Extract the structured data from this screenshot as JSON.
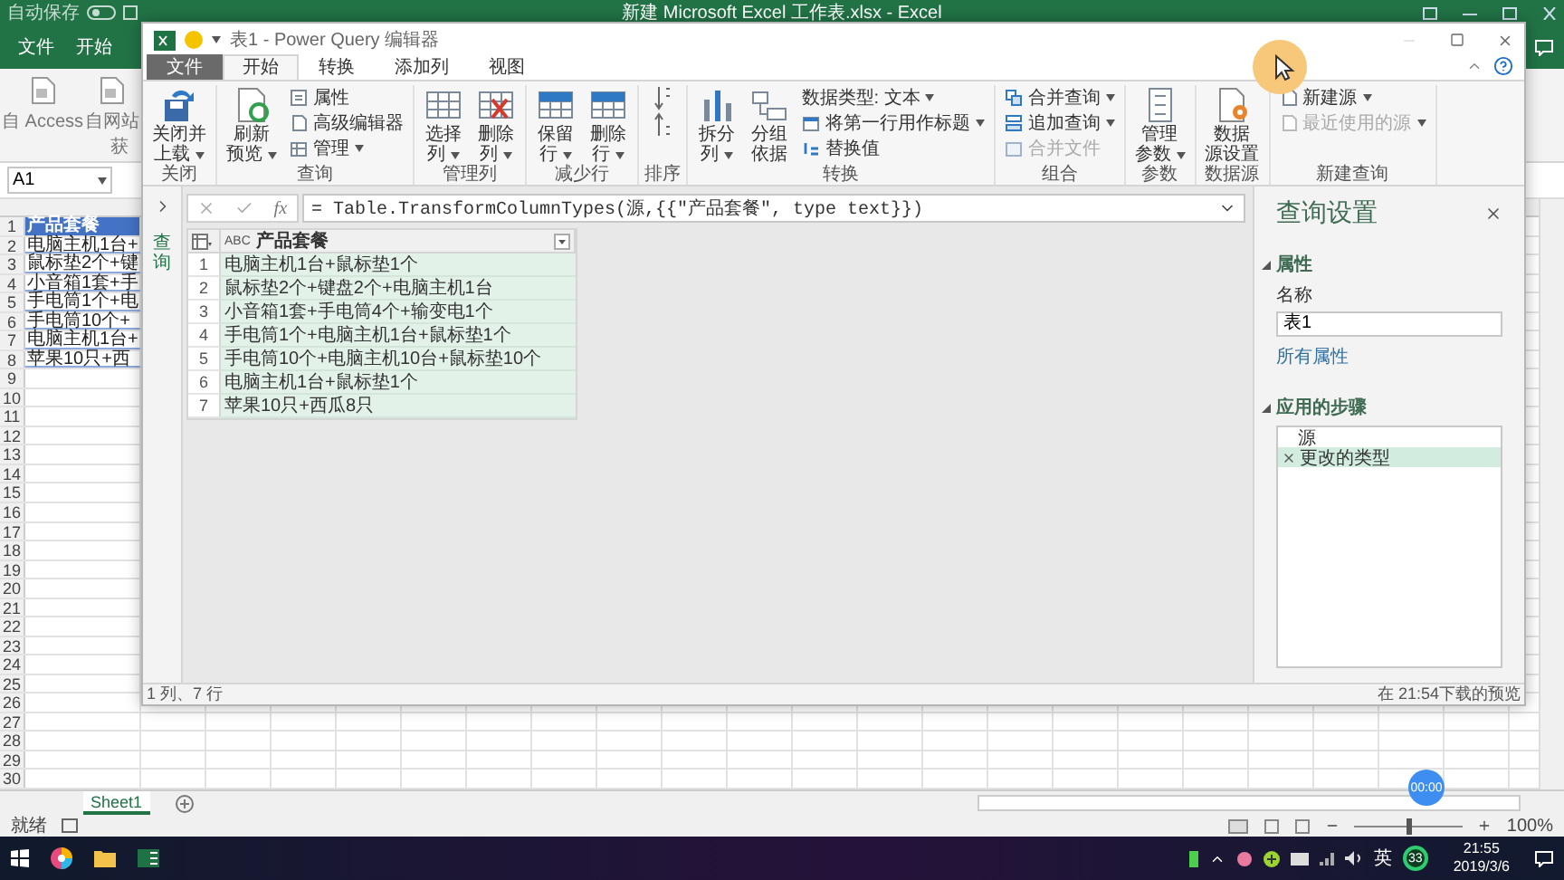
{
  "excel": {
    "autosave": "自动保存",
    "title": "新建 Microsoft Excel 工作表.xlsx - Excel",
    "tabs": [
      "文件",
      "开始"
    ],
    "ribbon_buttons": [
      "自 Access",
      "自网站"
    ],
    "group_label": "获",
    "name_box": "A1",
    "row_numbers": [
      "1",
      "2",
      "3",
      "4",
      "5",
      "6",
      "7",
      "8",
      "9",
      "10",
      "11",
      "12",
      "13",
      "14",
      "15",
      "16",
      "17",
      "18",
      "19",
      "20",
      "21",
      "22",
      "23",
      "24",
      "25",
      "26",
      "27",
      "28",
      "29",
      "30"
    ],
    "column_a": [
      {
        "kind": "header",
        "text": "产品套餐"
      },
      {
        "kind": "cell",
        "text": "电脑主机1台+"
      },
      {
        "kind": "cell",
        "text": "鼠标垫2个+键"
      },
      {
        "kind": "cell",
        "text": "小音箱1套+手"
      },
      {
        "kind": "cell",
        "text": "手电筒1个+电"
      },
      {
        "kind": "cell",
        "text": "手电筒10个+"
      },
      {
        "kind": "cell",
        "text": "电脑主机1台+"
      },
      {
        "kind": "cell",
        "text": "苹果10只+西"
      }
    ],
    "sheet_tabs": [
      {
        "label": "Sheet1",
        "selected": true
      }
    ],
    "status": "就绪",
    "zoom": {
      "level": 0.5,
      "reading": "100%"
    }
  },
  "editor": {
    "title": "表1 - Power Query 编辑器",
    "tabs": [
      {
        "kind": "file",
        "label": "文件",
        "selected": false
      },
      {
        "kind": "tab",
        "label": "开始",
        "selected": true
      },
      {
        "kind": "tab",
        "label": "转换",
        "selected": false
      },
      {
        "kind": "tab",
        "label": "添加列",
        "selected": false
      },
      {
        "kind": "tab",
        "label": "视图",
        "selected": false
      }
    ],
    "ribbon": [
      {
        "label": "关闭",
        "buttons": [
          {
            "kind": "large",
            "lines": [
              "关闭并",
              "上载"
            ],
            "dropdown": true,
            "disabled": false
          }
        ]
      },
      {
        "label": "查询",
        "buttons": [
          {
            "kind": "large",
            "lines": [
              "刷新",
              "预览"
            ],
            "dropdown": true,
            "disabled": false
          },
          {
            "kind": "small",
            "text": "属性",
            "dropdown": false,
            "disabled": false
          },
          {
            "kind": "small",
            "text": "高级编辑器",
            "dropdown": false,
            "disabled": false
          },
          {
            "kind": "small",
            "text": "管理",
            "dropdown": true,
            "disabled": false
          }
        ]
      },
      {
        "label": "管理列",
        "buttons": [
          {
            "kind": "large",
            "lines": [
              "选择",
              "列"
            ],
            "dropdown": true,
            "disabled": false
          },
          {
            "kind": "large",
            "lines": [
              "删除",
              "列"
            ],
            "dropdown": true,
            "disabled": false
          }
        ]
      },
      {
        "label": "减少行",
        "buttons": [
          {
            "kind": "large",
            "lines": [
              "保留",
              "行"
            ],
            "dropdown": true,
            "disabled": false
          },
          {
            "kind": "large",
            "lines": [
              "删除",
              "行"
            ],
            "dropdown": true,
            "disabled": false
          }
        ]
      },
      {
        "label": "排序",
        "buttons": [
          {
            "kind": "sort"
          }
        ]
      },
      {
        "label": "转换",
        "buttons": [
          {
            "kind": "large",
            "lines": [
              "拆分",
              "列"
            ],
            "dropdown": true,
            "disabled": false
          },
          {
            "kind": "large",
            "lines": [
              "分组",
              "依据"
            ],
            "dropdown": false,
            "disabled": false
          },
          {
            "kind": "small",
            "text": "数据类型: 文本",
            "dropdown": true,
            "disabled": false
          },
          {
            "kind": "small",
            "text": "将第一行用作标题",
            "dropdown": true,
            "disabled": false
          },
          {
            "kind": "small",
            "text": "替换值",
            "dropdown": false,
            "disabled": false
          }
        ]
      },
      {
        "label": "组合",
        "buttons": [
          {
            "kind": "small",
            "text": "合并查询",
            "dropdown": true,
            "disabled": false
          },
          {
            "kind": "small",
            "text": "追加查询",
            "dropdown": true,
            "disabled": false
          },
          {
            "kind": "small",
            "text": "合并文件",
            "dropdown": false,
            "disabled": true
          }
        ]
      },
      {
        "label": "参数",
        "buttons": [
          {
            "kind": "large",
            "lines": [
              "管理",
              "参数"
            ],
            "dropdown": true,
            "disabled": false
          }
        ]
      },
      {
        "label": "数据源",
        "buttons": [
          {
            "kind": "large",
            "lines": [
              "数据",
              "源设置"
            ],
            "dropdown": false,
            "disabled": false
          }
        ]
      },
      {
        "label": "新建查询",
        "buttons": [
          {
            "kind": "small",
            "text": "新建源",
            "dropdown": true,
            "disabled": false
          },
          {
            "kind": "small",
            "text": "最近使用的源",
            "dropdown": true,
            "disabled": true
          }
        ]
      }
    ],
    "queries_label": "查询",
    "formula_label": "fx",
    "formula": "= Table.TransformColumnTypes(源,{{\"产品套餐\", type text}})",
    "table": {
      "column_type": "ABC",
      "column": "产品套餐",
      "rows": [
        {
          "n": "1",
          "text": "电脑主机1台+鼠标垫1个"
        },
        {
          "n": "2",
          "text": "鼠标垫2个+键盘2个+电脑主机1台"
        },
        {
          "n": "3",
          "text": "小音箱1套+手电筒4个+输变电1个"
        },
        {
          "n": "4",
          "text": "手电筒1个+电脑主机1台+鼠标垫1个"
        },
        {
          "n": "5",
          "text": "手电筒10个+电脑主机10台+鼠标垫10个"
        },
        {
          "n": "6",
          "text": "电脑主机1台+鼠标垫1个"
        },
        {
          "n": "7",
          "text": "苹果10只+西瓜8只"
        }
      ]
    },
    "settings": {
      "title": "查询设置",
      "properties": {
        "heading": "属性",
        "expanded": true,
        "name_label": "名称",
        "name_value": "表1",
        "link": "所有属性"
      },
      "steps": {
        "heading": "应用的步骤",
        "expanded": true,
        "items": [
          {
            "label": "源",
            "selected": false
          },
          {
            "label": "更改的类型",
            "selected": true
          }
        ]
      }
    },
    "status_left": "1 列、7 行",
    "status_right": "在 21:54下载的预览"
  },
  "taskbar": {
    "ime": "英",
    "badge": "33",
    "time": "21:55",
    "date": "2019/3/6"
  },
  "timer": "00:00"
}
